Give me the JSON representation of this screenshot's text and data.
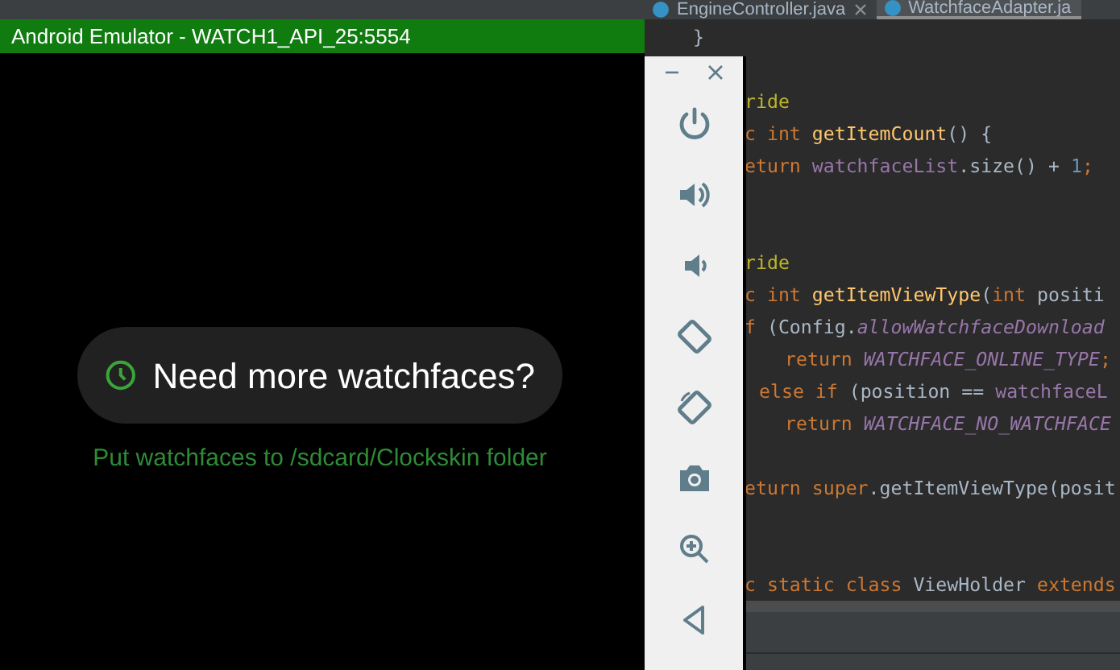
{
  "editor_tabs": [
    {
      "label": "EngineController.java",
      "selected": false,
      "closable": true
    },
    {
      "label": "WatchfaceAdapter.ja",
      "selected": true,
      "closable": false
    }
  ],
  "editor": {
    "brace_above": "}",
    "lines": [
      {
        "kind": "blank"
      },
      {
        "kind": "code",
        "tokens": [
          {
            "text": "ride",
            "kind": "annotation"
          }
        ]
      },
      {
        "kind": "code",
        "tokens": [
          {
            "text": "c int ",
            "kind": "keyword"
          },
          {
            "text": "getItemCount",
            "kind": "method"
          },
          {
            "text": "() {",
            "kind": "plain"
          }
        ]
      },
      {
        "kind": "code",
        "tokens": [
          {
            "text": "eturn ",
            "kind": "keyword"
          },
          {
            "text": "watchfaceList",
            "kind": "field"
          },
          {
            "text": ".size() + ",
            "kind": "plain"
          },
          {
            "text": "1",
            "kind": "number"
          },
          {
            "text": ";",
            "kind": "keyword"
          }
        ]
      },
      {
        "kind": "blank"
      },
      {
        "kind": "blank"
      },
      {
        "kind": "code",
        "tokens": [
          {
            "text": "ride",
            "kind": "annotation"
          }
        ]
      },
      {
        "kind": "code",
        "tokens": [
          {
            "text": "c int ",
            "kind": "keyword"
          },
          {
            "text": "getItemViewType",
            "kind": "method"
          },
          {
            "text": "(",
            "kind": "plain"
          },
          {
            "text": "int ",
            "kind": "keyword"
          },
          {
            "text": "positi",
            "kind": "plain"
          }
        ]
      },
      {
        "kind": "code",
        "tokens": [
          {
            "text": "f ",
            "kind": "keyword"
          },
          {
            "text": "(Config.",
            "kind": "plain"
          },
          {
            "text": "allowWatchfaceDownload",
            "kind": "constant"
          }
        ]
      },
      {
        "kind": "nested",
        "tokens": [
          {
            "text": "return ",
            "kind": "keyword"
          },
          {
            "text": "WATCHFACE_ONLINE_TYPE",
            "kind": "constant"
          },
          {
            "text": ";",
            "kind": "keyword"
          }
        ]
      },
      {
        "kind": "branch",
        "tokens": [
          {
            "text": "else if ",
            "kind": "keyword"
          },
          {
            "text": "(position == ",
            "kind": "plain"
          },
          {
            "text": "watchfaceL",
            "kind": "field"
          }
        ]
      },
      {
        "kind": "nested",
        "tokens": [
          {
            "text": "return ",
            "kind": "keyword"
          },
          {
            "text": "WATCHFACE_NO_WATCHFACE",
            "kind": "constant"
          }
        ]
      },
      {
        "kind": "blank"
      },
      {
        "kind": "code",
        "tokens": [
          {
            "text": "eturn super",
            "kind": "keyword"
          },
          {
            "text": ".getItemViewType(posit",
            "kind": "plain"
          }
        ]
      },
      {
        "kind": "blank"
      },
      {
        "kind": "blank"
      },
      {
        "kind": "code",
        "tokens": [
          {
            "text": "c static class ",
            "kind": "keyword"
          },
          {
            "text": "ViewHolder ",
            "kind": "plain"
          },
          {
            "text": "extends",
            "kind": "keyword"
          }
        ]
      }
    ]
  },
  "emulator": {
    "title": "Android Emulator - WATCH1_API_25:5554",
    "prompt": "Need more watchfaces?",
    "hint": "Put watchfaces to /sdcard/Clockskin folder"
  },
  "toolbar": {
    "buttons": [
      {
        "kind": "power"
      },
      {
        "kind": "volume-up"
      },
      {
        "kind": "volume-down"
      },
      {
        "kind": "rotate-left"
      },
      {
        "kind": "rotate-right"
      },
      {
        "kind": "camera"
      },
      {
        "kind": "zoom"
      },
      {
        "kind": "back"
      }
    ]
  }
}
